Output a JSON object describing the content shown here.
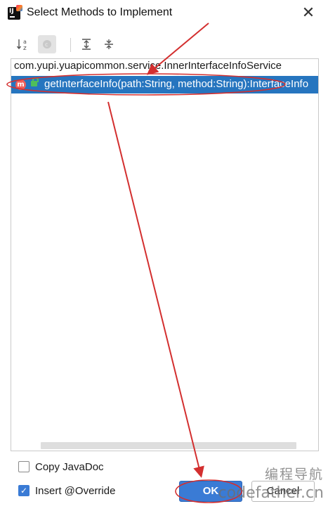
{
  "window": {
    "title": "Select Methods to Implement",
    "close_glyph": "✕"
  },
  "toolbar": {
    "sort_icon": "sort-alpha-icon",
    "show_classes_icon": "show-classes-icon",
    "expand_icon": "expand-all-icon",
    "collapse_icon": "collapse-all-icon"
  },
  "tree": {
    "class_node": "com.yupi.yuapicommon.service.InnerInterfaceInfoService",
    "methods": [
      {
        "badge": "m",
        "signature": "getInterfaceInfo(path:String, method:String):InterfaceInfo",
        "selected": true
      }
    ]
  },
  "options": {
    "copy_javadoc": {
      "label": "Copy JavaDoc",
      "checked": false
    },
    "insert_override": {
      "label": "Insert @Override",
      "checked": true
    }
  },
  "buttons": {
    "ok": "OK",
    "cancel": "Cancel"
  },
  "watermark": {
    "line1": "编程导航",
    "line2": "codefather.cn"
  },
  "colors": {
    "selection": "#2675bf",
    "primary_button": "#3a7bd5",
    "annotation_red": "#d32f2f"
  }
}
